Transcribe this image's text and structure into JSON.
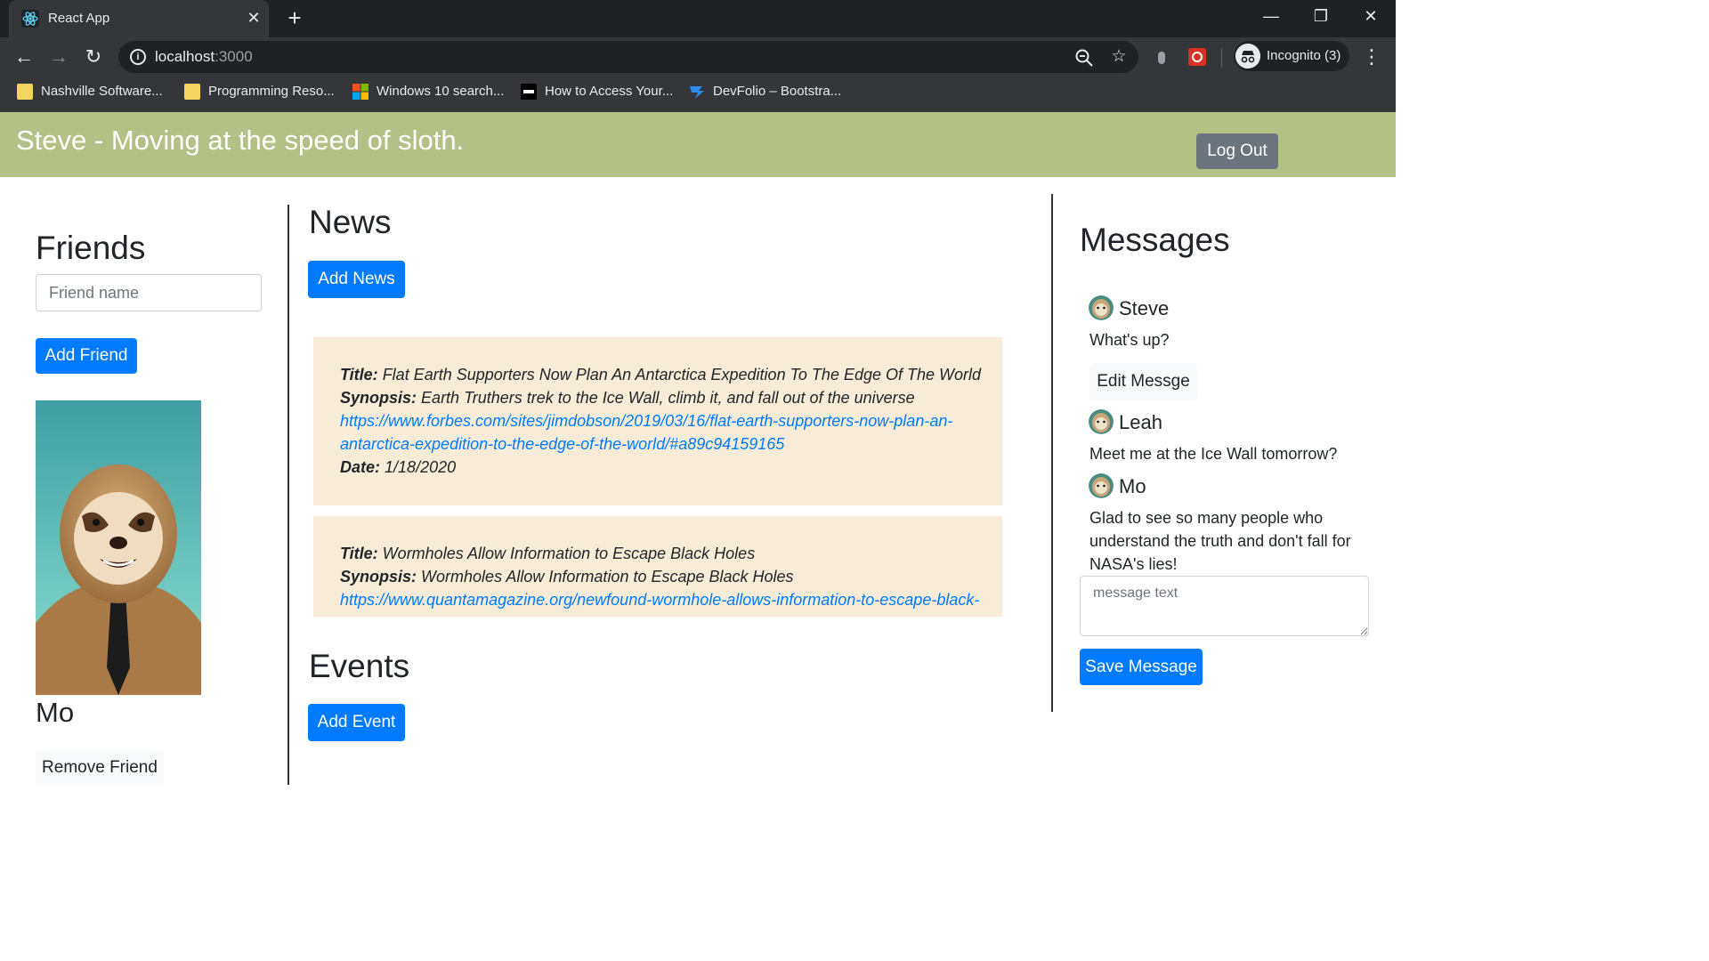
{
  "browser": {
    "tab_title": "React App",
    "url_host": "localhost",
    "url_port": ":3000",
    "incognito_label": "Incognito (3)",
    "bookmarks": [
      {
        "label": "Nashville Software..."
      },
      {
        "label": "Programming Reso..."
      },
      {
        "label": "Windows 10 search..."
      },
      {
        "label": "How to Access Your..."
      },
      {
        "label": "DevFolio – Bootstra..."
      }
    ]
  },
  "header": {
    "title": "Steve - Moving at the speed of sloth.",
    "logout_label": "Log Out"
  },
  "friends": {
    "heading": "Friends",
    "input_placeholder": "Friend name",
    "add_label": "Add Friend",
    "friend_name": "Mo",
    "remove_label": "Remove Friend"
  },
  "news": {
    "heading": "News",
    "add_label": "Add News",
    "title_label": "Title:",
    "synopsis_label": "Synopsis:",
    "date_label": "Date:",
    "items": [
      {
        "title": "Flat Earth Supporters Now Plan An Antarctica Expedition To The Edge Of The World",
        "synopsis": "Earth Truthers trek to the Ice Wall, climb it, and fall out of the universe",
        "url_line1": "https://www.forbes.com/sites/jimdobson/2019/03/16/flat-earth-supporters-now-plan-an-",
        "url_line2": "antarctica-expedition-to-the-edge-of-the-world/#a89c94159165",
        "date": "1/18/2020"
      },
      {
        "title": "Wormholes Allow Information to Escape Black Holes",
        "synopsis": "Wormholes Allow Information to Escape Black Holes",
        "url_line1": "https://www.quantamagazine.org/newfound-wormhole-allows-information-to-escape-black-"
      }
    ]
  },
  "events": {
    "heading": "Events",
    "add_label": "Add Event"
  },
  "messages": {
    "heading": "Messages",
    "items": [
      {
        "user": "Steve",
        "text": "What's up?",
        "edit_label": "Edit Messge"
      },
      {
        "user": "Leah",
        "text": "Meet me at the Ice Wall tomorrow?"
      },
      {
        "user": "Mo",
        "text_lines": [
          "Glad to see so many people who",
          "understand the truth and don't fall for",
          "NASA's lies!"
        ]
      }
    ],
    "textarea_placeholder": "message text",
    "save_label": "Save Message"
  },
  "colors": {
    "header_bg": "#b3c186",
    "primary": "#007bff",
    "news_card_bg": "#f7ecd7"
  }
}
